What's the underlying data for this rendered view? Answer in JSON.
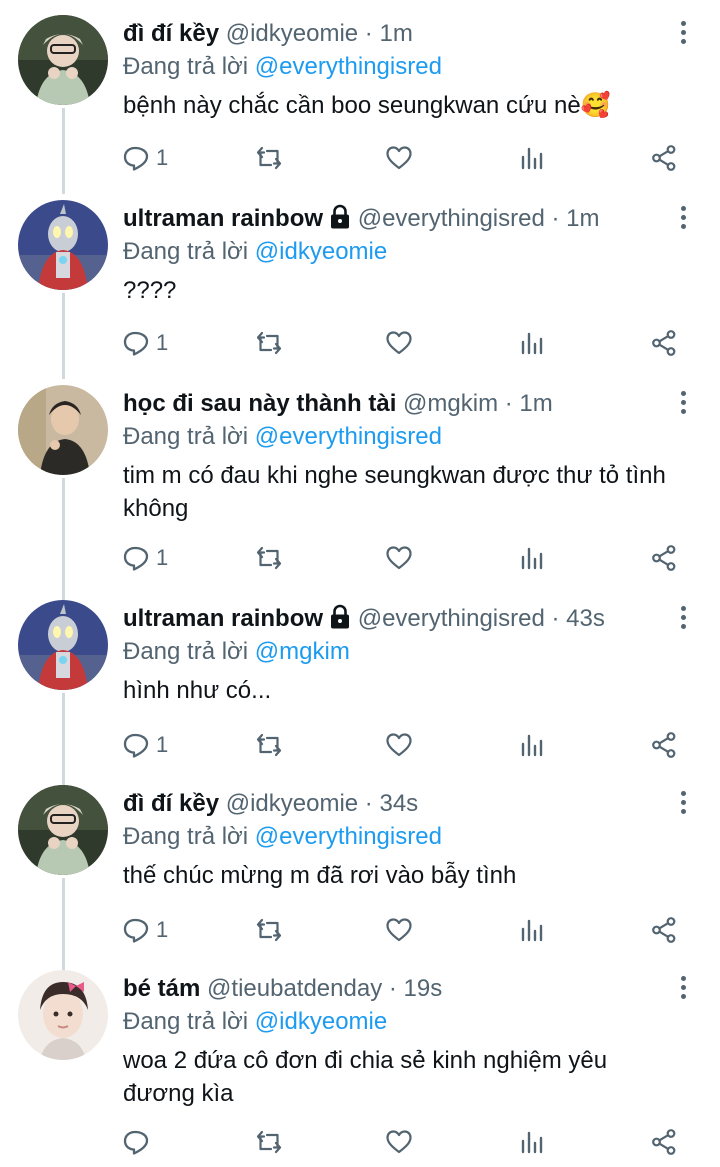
{
  "replying_label": "Đang trả lời",
  "tweets": [
    {
      "name": "đì đí kềy",
      "locked": false,
      "handle": "@idkyeomie",
      "time": "1m",
      "reply_to": "@everythingisred",
      "text": "bệnh này chắc cần boo seungkwan cứu nè🥰",
      "reply_count": "1",
      "avatar": "avatar-idkyeomie"
    },
    {
      "name": "ultraman rainbow",
      "locked": true,
      "handle": "@everythingisred",
      "time": "1m",
      "reply_to": "@idkyeomie",
      "text": "????",
      "reply_count": "1",
      "avatar": "avatar-ultraman"
    },
    {
      "name": "học đi sau này thành tài",
      "locked": false,
      "handle": "@mgkim",
      "time": "1m",
      "reply_to": "@everythingisred",
      "text": "tim m có đau khi nghe seungkwan được thư tỏ tình không",
      "reply_count": "1",
      "avatar": "avatar-mgkim"
    },
    {
      "name": "ultraman rainbow",
      "locked": true,
      "handle": "@everythingisred",
      "time": "43s",
      "reply_to": "@mgkim",
      "text": "hình như có...",
      "reply_count": "1",
      "avatar": "avatar-ultraman"
    },
    {
      "name": "đì đí kềy",
      "locked": false,
      "handle": "@idkyeomie",
      "time": "34s",
      "reply_to": "@everythingisred",
      "text": "thế chúc mừng m đã rơi vào bẫy tình",
      "reply_count": "1",
      "avatar": "avatar-idkyeomie"
    },
    {
      "name": "bé tám",
      "locked": false,
      "handle": "@tieubatdenday",
      "time": "19s",
      "reply_to": "@idkyeomie",
      "text": "woa 2 đứa cô đơn đi chia sẻ kinh nghiệm yêu đương kìa",
      "reply_count": "",
      "avatar": "avatar-tieubatdenday"
    }
  ],
  "icons": {
    "reply": "reply-icon",
    "retweet": "retweet-icon",
    "like": "like-icon",
    "analytics": "analytics-icon",
    "share": "share-icon",
    "more": "more-icon",
    "lock": "lock-icon"
  },
  "colors": {
    "link": "#1d9bf0",
    "secondary_text": "#536471",
    "primary_text": "#0f1419",
    "thread_line": "#cfd9de"
  }
}
